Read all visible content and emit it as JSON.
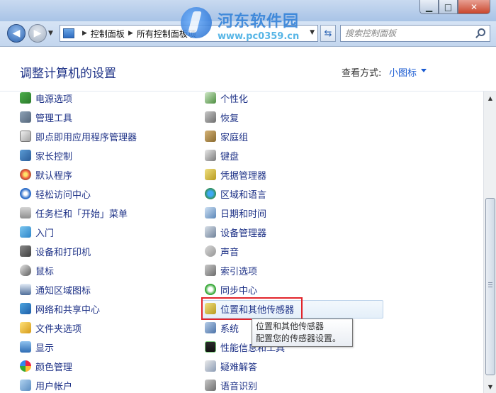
{
  "window": {
    "minimize_label": "▁",
    "maximize_label": "□",
    "close_label": "✕"
  },
  "watermark": {
    "name": "河东软件园",
    "url": "www.pc0359.cn"
  },
  "address": {
    "crumbs": [
      "控制面板",
      "所有控制面板项"
    ]
  },
  "search": {
    "placeholder": "搜索控制面板"
  },
  "header": {
    "title": "调整计算机的设置",
    "view_by_label": "查看方式:",
    "view_by_value": "小图标"
  },
  "items_left": [
    {
      "label": "电源选项",
      "icon": "power-icon"
    },
    {
      "label": "管理工具",
      "icon": "admin-tools-icon"
    },
    {
      "label": "即点即用应用程序管理器",
      "icon": "click-to-run-icon"
    },
    {
      "label": "家长控制",
      "icon": "parental-control-icon"
    },
    {
      "label": "默认程序",
      "icon": "default-programs-icon"
    },
    {
      "label": "轻松访问中心",
      "icon": "ease-of-access-icon"
    },
    {
      "label": "任务栏和「开始」菜单",
      "icon": "taskbar-icon"
    },
    {
      "label": "入门",
      "icon": "getting-started-icon"
    },
    {
      "label": "设备和打印机",
      "icon": "printer-icon"
    },
    {
      "label": "鼠标",
      "icon": "mouse-icon"
    },
    {
      "label": "通知区域图标",
      "icon": "notification-icon"
    },
    {
      "label": "网络和共享中心",
      "icon": "network-icon"
    },
    {
      "label": "文件夹选项",
      "icon": "folder-options-icon"
    },
    {
      "label": "显示",
      "icon": "display-icon"
    },
    {
      "label": "颜色管理",
      "icon": "color-management-icon"
    },
    {
      "label": "用户帐户",
      "icon": "user-accounts-icon"
    }
  ],
  "items_right": [
    {
      "label": "个性化",
      "icon": "personalization-icon"
    },
    {
      "label": "恢复",
      "icon": "recovery-icon"
    },
    {
      "label": "家庭组",
      "icon": "homegroup-icon"
    },
    {
      "label": "键盘",
      "icon": "keyboard-icon"
    },
    {
      "label": "凭据管理器",
      "icon": "credential-icon"
    },
    {
      "label": "区域和语言",
      "icon": "region-language-icon"
    },
    {
      "label": "日期和时间",
      "icon": "date-time-icon"
    },
    {
      "label": "设备管理器",
      "icon": "device-manager-icon"
    },
    {
      "label": "声音",
      "icon": "sound-icon"
    },
    {
      "label": "索引选项",
      "icon": "indexing-icon"
    },
    {
      "label": "同步中心",
      "icon": "sync-center-icon"
    },
    {
      "label": "位置和其他传感器",
      "icon": "location-sensors-icon"
    },
    {
      "label": "系统",
      "icon": "system-icon"
    },
    {
      "label": "性能信息和工具",
      "icon": "performance-icon"
    },
    {
      "label": "疑难解答",
      "icon": "troubleshooting-icon"
    },
    {
      "label": "语音识别",
      "icon": "speech-icon"
    }
  ],
  "tooltip": {
    "title": "位置和其他传感器",
    "description": "配置您的传感器设置。"
  },
  "colors": {
    "link": "#1e3287",
    "accent": "#1a5bd2",
    "highlight_border": "#e2252b"
  }
}
